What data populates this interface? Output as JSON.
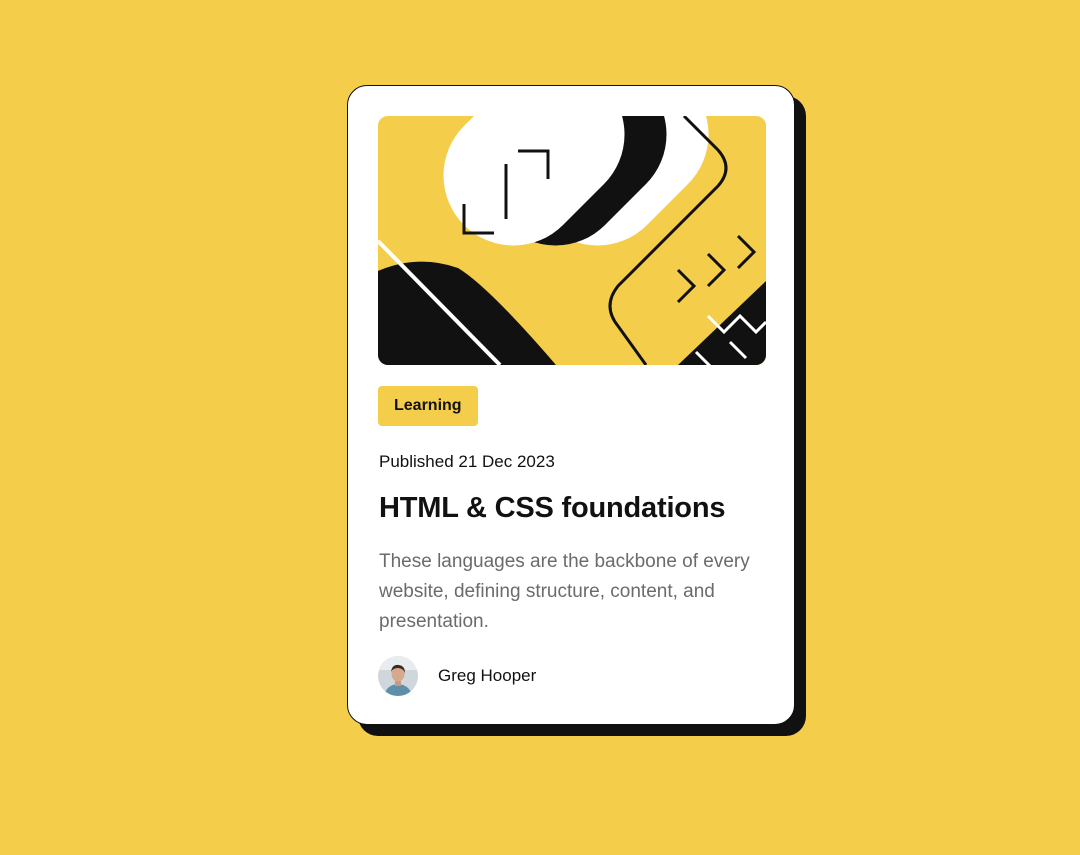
{
  "card": {
    "category": "Learning",
    "published": "Published 21 Dec 2023",
    "title": "HTML & CSS foundations",
    "description": "These languages are the backbone of every website, defining structure, content, and presentation.",
    "author": {
      "name": "Greg Hooper"
    }
  },
  "colors": {
    "background": "#F4CE4B",
    "card": "#FFFFFF",
    "ink": "#111111",
    "muted": "#6B6B6B"
  },
  "illustration": {
    "icon": "code-bracket-illustration"
  }
}
